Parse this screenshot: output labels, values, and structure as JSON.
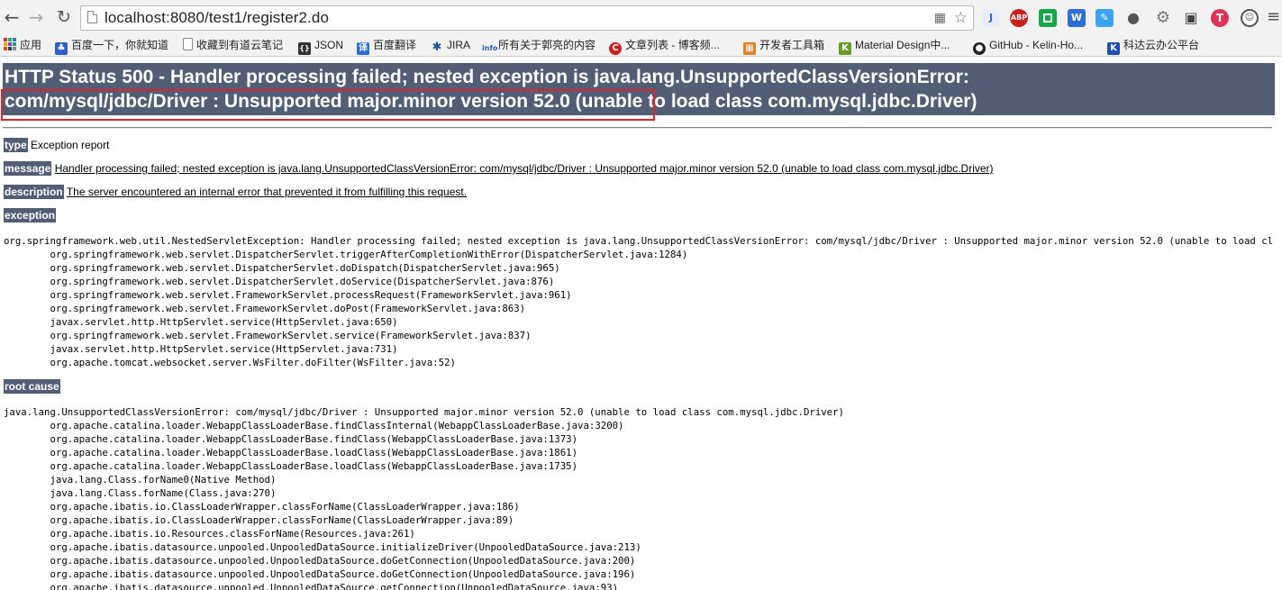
{
  "browser": {
    "url": "localhost:8080/test1/register2.do",
    "bookmarks": [
      {
        "label": "应用",
        "icon": "apps-grid-icon"
      },
      {
        "label": "百度一下，你就知道",
        "icon": "baidu-paw-icon"
      },
      {
        "label": "收藏到有道云笔记",
        "icon": "document-icon"
      },
      {
        "label": "JSON",
        "icon": "json-icon"
      },
      {
        "label": "百度翻译",
        "icon": "baidu-translate-icon"
      },
      {
        "label": "JIRA",
        "icon": "jira-icon"
      },
      {
        "label": "所有关于郭亮的内容",
        "icon": "info-icon"
      },
      {
        "label": "文章列表 - 博客频...",
        "icon": "csdn-icon"
      },
      {
        "label": "开发者工具箱",
        "icon": "toolbox-icon"
      },
      {
        "label": "Material Design中...",
        "icon": "material-design-icon"
      },
      {
        "label": "GitHub - Kelin-Ho...",
        "icon": "github-icon"
      },
      {
        "label": "科达云办公平台",
        "icon": "kedacom-icon"
      }
    ]
  },
  "error_page": {
    "title_line1": "HTTP Status 500 - Handler processing failed; nested exception is java.lang.UnsupportedClassVersionError:",
    "title_line2_highlighted": "com/mysql/jdbc/Driver : Unsupported major.minor version 52.0",
    "title_line2_rest": " (unable to load class com.mysql.jdbc.Driver)",
    "type_label": "type",
    "type_value": " Exception report",
    "message_label": "message",
    "message_value": "Handler processing failed; nested exception is java.lang.UnsupportedClassVersionError: com/mysql/jdbc/Driver : Unsupported major.minor version 52.0 (unable to load class com.mysql.jdbc.Driver)",
    "description_label": "description",
    "description_value": "The server encountered an internal error that prevented it from fulfilling this request.",
    "exception_label": "exception",
    "exception_trace": "org.springframework.web.util.NestedServletException: Handler processing failed; nested exception is java.lang.UnsupportedClassVersionError: com/mysql/jdbc/Driver : Unsupported major.minor version 52.0 (unable to load cl\n\torg.springframework.web.servlet.DispatcherServlet.triggerAfterCompletionWithError(DispatcherServlet.java:1284)\n\torg.springframework.web.servlet.DispatcherServlet.doDispatch(DispatcherServlet.java:965)\n\torg.springframework.web.servlet.DispatcherServlet.doService(DispatcherServlet.java:876)\n\torg.springframework.web.servlet.FrameworkServlet.processRequest(FrameworkServlet.java:961)\n\torg.springframework.web.servlet.FrameworkServlet.doPost(FrameworkServlet.java:863)\n\tjavax.servlet.http.HttpServlet.service(HttpServlet.java:650)\n\torg.springframework.web.servlet.FrameworkServlet.service(FrameworkServlet.java:837)\n\tjavax.servlet.http.HttpServlet.service(HttpServlet.java:731)\n\torg.apache.tomcat.websocket.server.WsFilter.doFilter(WsFilter.java:52)",
    "root_cause_label": "root cause",
    "root_cause_trace": "java.lang.UnsupportedClassVersionError: com/mysql/jdbc/Driver : Unsupported major.minor version 52.0 (unable to load class com.mysql.jdbc.Driver)\n\torg.apache.catalina.loader.WebappClassLoaderBase.findClassInternal(WebappClassLoaderBase.java:3200)\n\torg.apache.catalina.loader.WebappClassLoaderBase.findClass(WebappClassLoaderBase.java:1373)\n\torg.apache.catalina.loader.WebappClassLoaderBase.loadClass(WebappClassLoaderBase.java:1861)\n\torg.apache.catalina.loader.WebappClassLoaderBase.loadClass(WebappClassLoaderBase.java:1735)\n\tjava.lang.Class.forName0(Native Method)\n\tjava.lang.Class.forName(Class.java:270)\n\torg.apache.ibatis.io.ClassLoaderWrapper.classForName(ClassLoaderWrapper.java:186)\n\torg.apache.ibatis.io.ClassLoaderWrapper.classForName(ClassLoaderWrapper.java:89)\n\torg.apache.ibatis.io.Resources.classForName(Resources.java:261)\n\torg.apache.ibatis.datasource.unpooled.UnpooledDataSource.initializeDriver(UnpooledDataSource.java:213)\n\torg.apache.ibatis.datasource.unpooled.UnpooledDataSource.doGetConnection(UnpooledDataSource.java:200)\n\torg.apache.ibatis.datasource.unpooled.UnpooledDataSource.doGetConnection(UnpooledDataSource.java:196)\n\torg.apache.ibatis.datasource.unpooled.UnpooledDataSource.getConnection(UnpooledDataSource.java:93)"
  },
  "colors": {
    "tomcat_header_bg": "#525d76",
    "highlight_border": "#e0222a"
  }
}
